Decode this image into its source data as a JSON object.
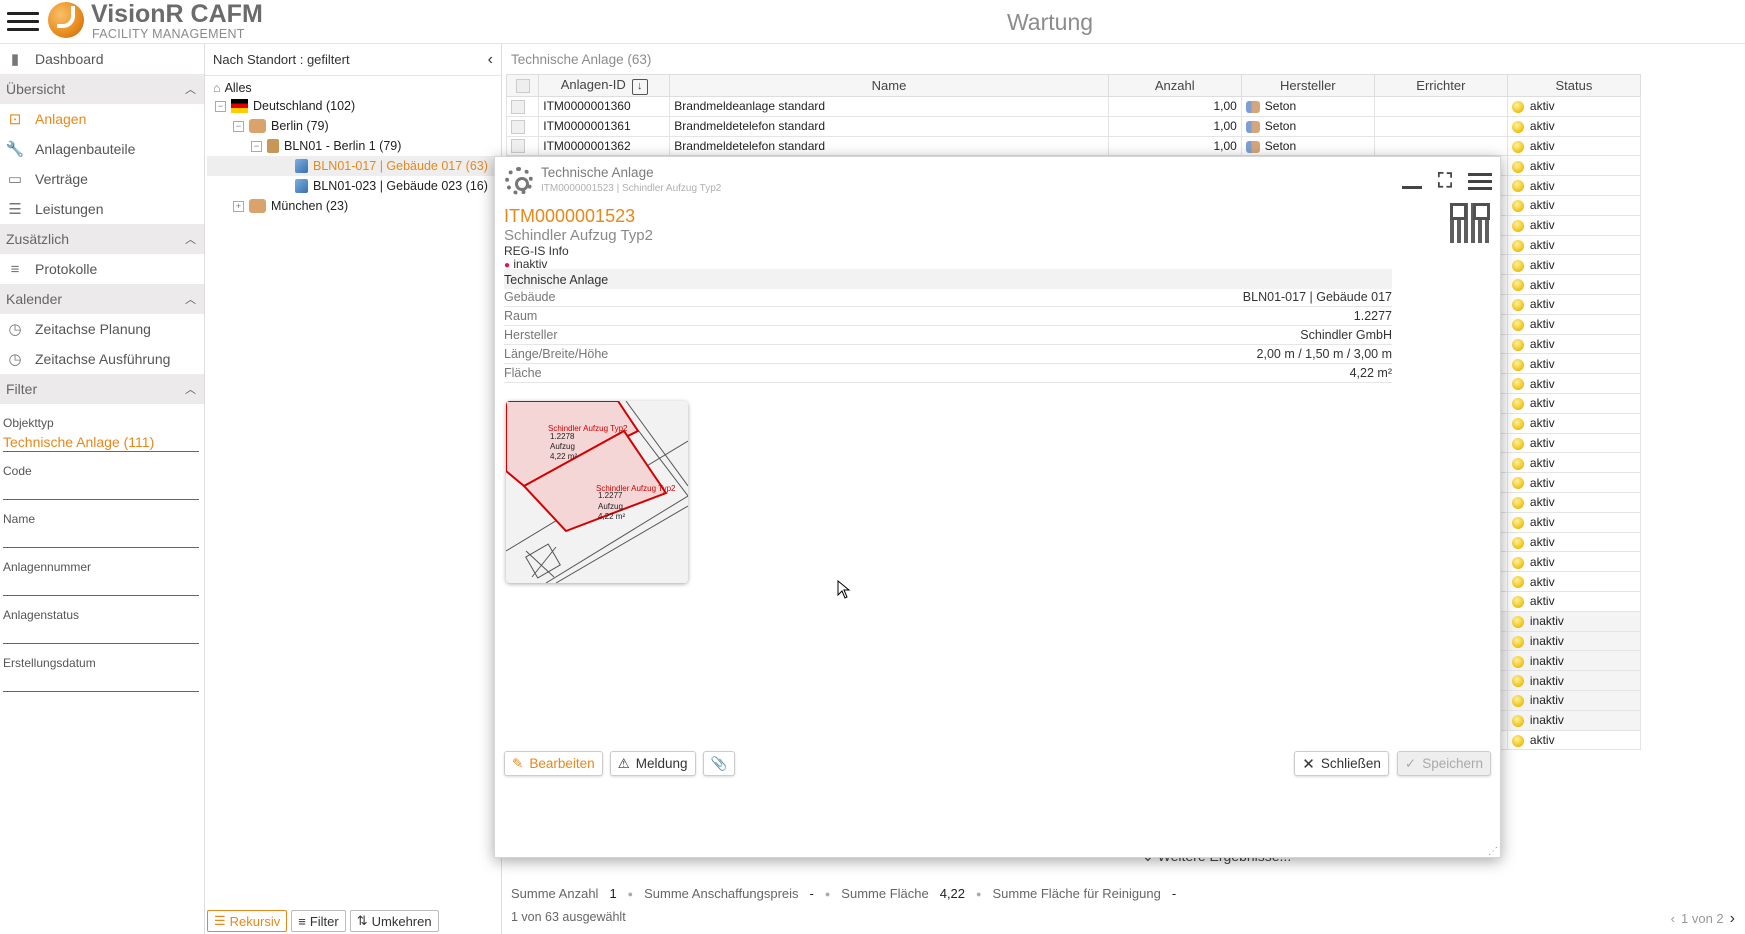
{
  "app": {
    "title": "VisionR CAFM",
    "subtitle": "FACILITY MANAGEMENT",
    "page_title": "Wartung"
  },
  "nav": {
    "dashboard": "Dashboard",
    "sec_uebersicht": "Übersicht",
    "anlagen": "Anlagen",
    "anlagenbauteile": "Anlagenbauteile",
    "vertraege": "Verträge",
    "leistungen": "Leistungen",
    "sec_zusaetzlich": "Zusätzlich",
    "protokolle": "Protokolle",
    "sec_kalender": "Kalender",
    "zeitachse_planung": "Zeitachse Planung",
    "zeitachse_ausfuehrung": "Zeitachse Ausführung",
    "sec_filter": "Filter"
  },
  "filter": {
    "objekttyp_label": "Objekttyp",
    "objekttyp_value": "Technische Anlage (111)",
    "code_label": "Code",
    "name_label": "Name",
    "anlagennummer_label": "Anlagennummer",
    "anlagenstatus_label": "Anlagenstatus",
    "erstellungsdatum_label": "Erstellungsdatum"
  },
  "tree": {
    "header": "Nach Standort : gefiltert",
    "nodes": [
      "Alles",
      "Deutschland (102)",
      "Berlin (79)",
      "BLN01 - Berlin 1 (79)",
      "BLN01-017 | Gebäude 017 (63)",
      "BLN01-023 | Gebäude 023 (16)",
      "München (23)"
    ],
    "buttons": {
      "rekursiv": "Rekursiv",
      "filter": "Filter",
      "umkehren": "Umkehren"
    }
  },
  "table": {
    "title": "Technische Anlage (63)",
    "columns": [
      "Anlagen-ID",
      "Name",
      "Anzahl",
      "Hersteller",
      "Errichter",
      "Status"
    ],
    "rows": [
      {
        "id": "ITM0000001360",
        "name": "Brandmeldeanlage standard",
        "anzahl": "1,00",
        "hersteller": "Seton",
        "status": "aktiv"
      },
      {
        "id": "ITM0000001361",
        "name": "Brandmeldetelefon standard",
        "anzahl": "1,00",
        "hersteller": "Seton",
        "status": "aktiv"
      },
      {
        "id": "ITM0000001362",
        "name": "Brandmeldetelefon standard",
        "anzahl": "1,00",
        "hersteller": "Seton",
        "status": "aktiv"
      }
    ],
    "status_rest": [
      "aktiv",
      "aktiv",
      "aktiv",
      "aktiv",
      "aktiv",
      "aktiv",
      "aktiv",
      "aktiv",
      "aktiv",
      "aktiv",
      "aktiv",
      "aktiv",
      "aktiv",
      "aktiv",
      "aktiv",
      "aktiv",
      "aktiv",
      "aktiv",
      "aktiv",
      "aktiv",
      "aktiv",
      "aktiv",
      "aktiv",
      "inaktiv",
      "inaktiv",
      "inaktiv",
      "inaktiv",
      "inaktiv",
      "inaktiv",
      "aktiv"
    ],
    "more": "Weitere Ergebnisse..."
  },
  "footer": {
    "summe_anzahl_label": "Summe Anzahl",
    "summe_anzahl_value": "1",
    "summe_anschaffung_label": "Summe Anschaffungspreis",
    "summe_anschaffung_value": "-",
    "summe_flaeche_label": "Summe Fläche",
    "summe_flaeche_value": "4,22",
    "summe_reinigung_label": "Summe Fläche für Reinigung",
    "summe_reinigung_value": "-",
    "selected": "1 von 63 ausgewählt",
    "pager": "1 von 2"
  },
  "dialog": {
    "title": "Technische Anlage",
    "subtitle": "ITM0000001523 | Schindler Aufzug Typ2",
    "id": "ITM0000001523",
    "name": "Schindler Aufzug Typ2",
    "info": "REG-IS Info",
    "status": "inaktiv",
    "status_color": "#e0154f",
    "section": "Technische Anlage",
    "props": [
      {
        "k": "Gebäude",
        "v": "BLN01-017 | Gebäude 017"
      },
      {
        "k": "Raum",
        "v": "1.2277"
      },
      {
        "k": "Hersteller",
        "v": "Schindler GmbH"
      },
      {
        "k": "Länge/Breite/Höhe",
        "v": "2,00 m / 1,50 m / 3,00 m"
      },
      {
        "k": "Fläche",
        "v": "4,22 m²"
      }
    ],
    "plan": {
      "room1_name": "Schindler Aufzug Typ2",
      "room1_id": "1.2278",
      "room1_type": "Aufzug",
      "room1_area": "4,22 m²",
      "room2_name": "Schindler Aufzug Typ2",
      "room2_id": "1.2277",
      "room2_type": "Aufzug",
      "room2_area": "4,22 m²"
    },
    "buttons": {
      "bearbeiten": "Bearbeiten",
      "meldung": "Meldung",
      "schliessen": "Schließen",
      "speichern": "Speichern"
    }
  },
  "colors": {
    "accent": "#e8881a",
    "inactive": "#e0154f"
  }
}
